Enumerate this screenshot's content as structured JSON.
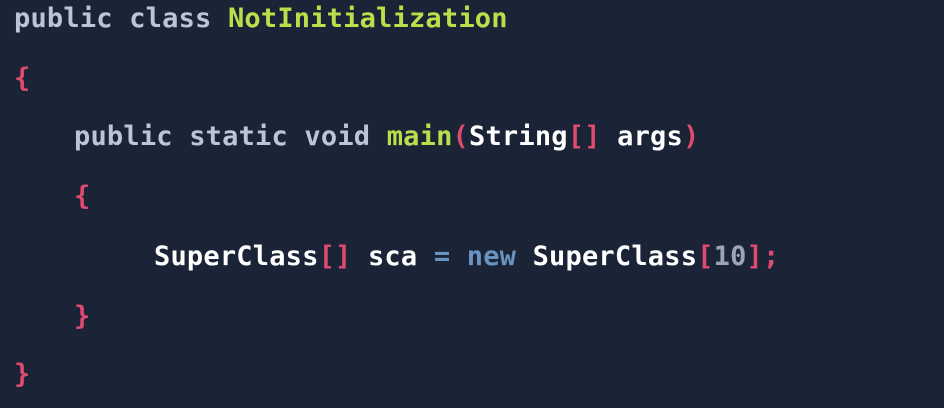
{
  "colors": {
    "background": "#1b2437",
    "keyword": "#b9c6d3",
    "identifier": "#ffffff",
    "class_name": "#b8e04a",
    "method_name": "#b8e04a",
    "punctuation": "#e04a6e",
    "number": "#9aa6b4",
    "operator": "#6a93c2"
  },
  "code": {
    "line1": {
      "kw_public": "public",
      "kw_class": "class",
      "class_name": "NotInitialization"
    },
    "line2": {
      "brace_open": "{"
    },
    "line3": {
      "kw_public": "public",
      "kw_static": "static",
      "kw_void": "void",
      "method": "main",
      "paren_open": "(",
      "type": "String",
      "bracket_open": "[",
      "bracket_close": "]",
      "param": "args",
      "paren_close": ")"
    },
    "line4": {
      "brace_open": "{"
    },
    "line5": {
      "type": "SuperClass",
      "bracket_open": "[",
      "bracket_close": "]",
      "var": "sca",
      "assign": "=",
      "kw_new": "new",
      "type2": "SuperClass",
      "bracket_open2": "[",
      "size": "10",
      "bracket_close2": "]",
      "semicolon": ";"
    },
    "line6": {
      "brace_close": "}"
    },
    "line7": {
      "brace_close": "}"
    }
  }
}
